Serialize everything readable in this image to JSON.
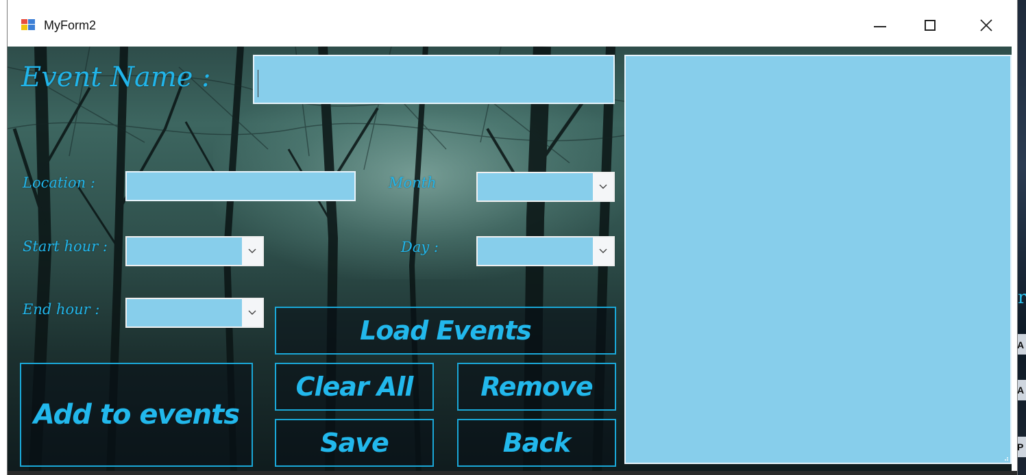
{
  "window": {
    "title": "MyForm2"
  },
  "form": {
    "event_name_label": "Event Name :",
    "event_name_value": "",
    "location_label": "Location :",
    "location_value": "",
    "month_label": "Month",
    "month_value": "",
    "start_hour_label": "Start hour :",
    "start_hour_value": "",
    "day_label": "Day :",
    "day_value": "",
    "end_hour_label": "End hour :",
    "end_hour_value": ""
  },
  "buttons": {
    "load_events": "Load Events",
    "clear_all": "Clear All",
    "remove": "Remove",
    "add_to_events": "Add to events",
    "save": "Save",
    "back": "Back"
  },
  "events_list": {
    "items": []
  },
  "desktop_edge_glyphs": [
    "A",
    "A",
    "P"
  ],
  "colors": {
    "field_bg": "#87ceeb",
    "accent": "#21b5ea",
    "button_border": "#1aa8d8"
  },
  "icons": {
    "app": "winforms-app-icon",
    "minimize": "minimize-icon",
    "maximize": "maximize-icon",
    "close": "close-icon",
    "dropdown": "chevron-down-icon"
  }
}
